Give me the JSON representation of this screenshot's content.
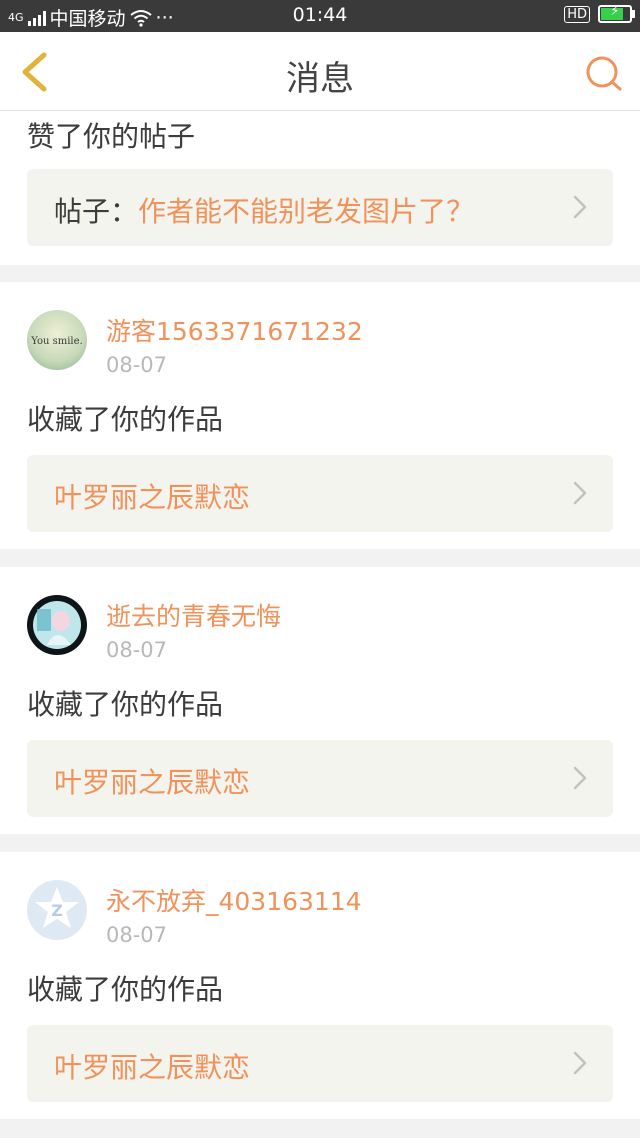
{
  "status_bar": {
    "network": "4G",
    "carrier": "中国移动",
    "extra": "···",
    "time": "01:44",
    "hd": "HD",
    "battery_level": 0.85
  },
  "header": {
    "title": "消息",
    "back_icon": "chevron-left-icon",
    "search_icon": "search-icon"
  },
  "colors": {
    "accent": "#f0925a",
    "back": "#e2b33a",
    "text": "#3c3c3c",
    "muted": "#b8b8b8",
    "link_bg": "#f4f4ef",
    "divider": "#f2f2f2"
  },
  "partial_card": {
    "action": "赞了你的帖子",
    "link_prefix": "帖子：",
    "link_title": "作者能不能别老发图片了？"
  },
  "messages": [
    {
      "username": "游客1563371671232",
      "date": "08-07",
      "action": "收藏了你的作品",
      "link_title": "叶罗丽之辰默恋",
      "avatar_text": "You smile."
    },
    {
      "username": "逝去的青春无悔",
      "date": "08-07",
      "action": "收藏了你的作品",
      "link_title": "叶罗丽之辰默恋"
    },
    {
      "username": "永不放弃_403163114",
      "date": "08-07",
      "action": "收藏了你的作品",
      "link_title": "叶罗丽之辰默恋"
    }
  ]
}
